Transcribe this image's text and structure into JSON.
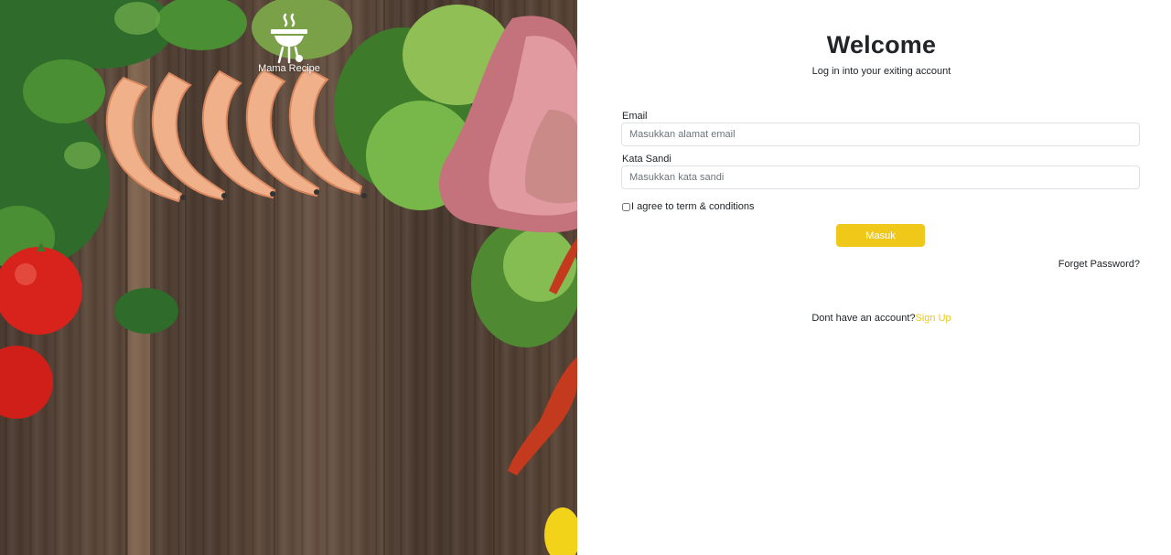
{
  "brand": {
    "name": "Mama Recipe",
    "icon": "chef-grill-icon"
  },
  "login": {
    "title": "Welcome",
    "subtitle": "Log in into your exiting account",
    "email_label": "Email",
    "email_placeholder": "Masukkan alamat email",
    "password_label": "Kata Sandi",
    "password_placeholder": "Masukkan kata sandi",
    "agree_label": "I agree to term & conditions",
    "submit_label": "Masuk",
    "forget_label": "Forget Password?",
    "signup_prompt": "Dont have an account?",
    "signup_link": "Sign Up"
  },
  "colors": {
    "accent": "#efc81a",
    "text": "#212529"
  }
}
